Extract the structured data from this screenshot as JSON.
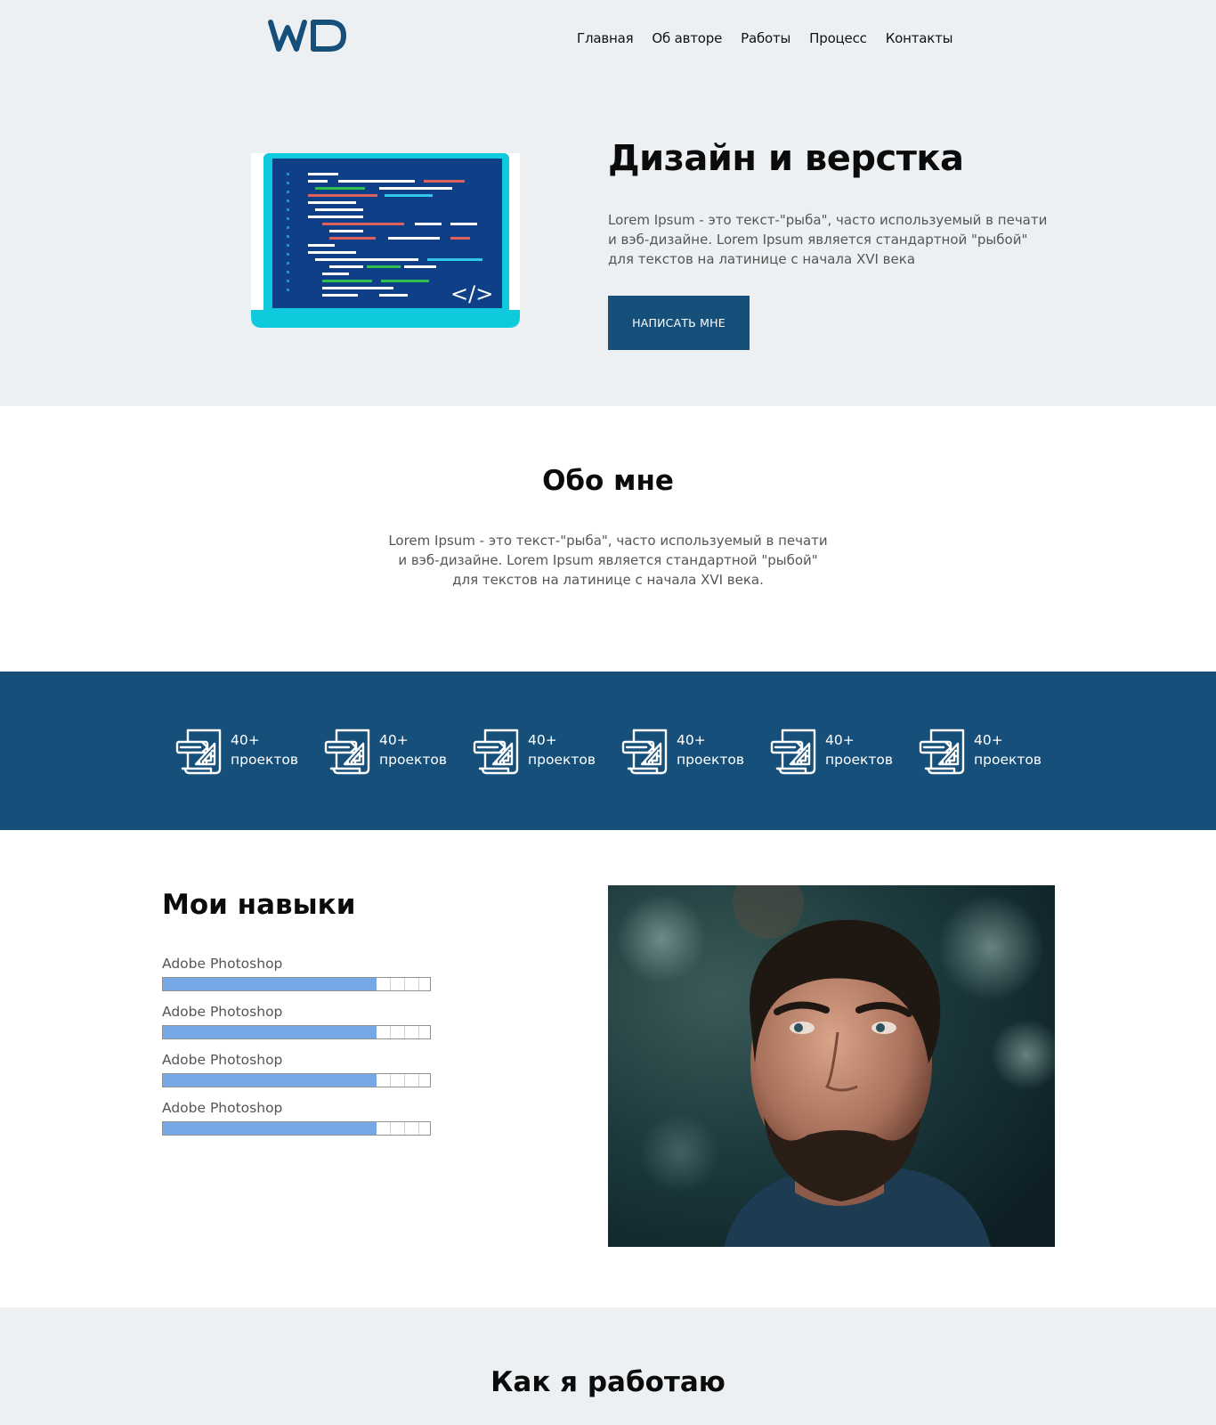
{
  "header": {
    "logo_text": "WD",
    "nav": [
      "Главная",
      "Об авторе",
      "Работы",
      "Процесс",
      "Контакты"
    ]
  },
  "hero": {
    "title": "Дизайн и верстка",
    "text": "Lorem Ipsum - это текст-\"рыба\", часто используемый в печати и вэб-дизайне. Lorem Ipsum является стандартной \"рыбой\" для текстов на латинице с начала XVI века",
    "button_label": "НАПИСАТЬ МНЕ",
    "code_glyph": "</>"
  },
  "about": {
    "title": "Обо мне",
    "text": "Lorem Ipsum - это текст-\"рыба\", часто используемый в печати и вэб-дизайне. Lorem Ipsum является стандартной \"рыбой\" для текстов на латинице с начала XVI века."
  },
  "stats": [
    {
      "value": "40+",
      "label": "проектов",
      "icon": "blueprint-icon"
    },
    {
      "value": "40+",
      "label": "проектов",
      "icon": "blueprint-icon"
    },
    {
      "value": "40+",
      "label": "проектов",
      "icon": "blueprint-icon"
    },
    {
      "value": "40+",
      "label": "проектов",
      "icon": "blueprint-icon"
    },
    {
      "value": "40+",
      "label": "проектов",
      "icon": "blueprint-icon"
    },
    {
      "value": "40+",
      "label": "проектов",
      "icon": "blueprint-icon"
    }
  ],
  "skills": {
    "title": "Мои навыки",
    "items": [
      {
        "label": "Adobe Photoshop",
        "level": 0.8
      },
      {
        "label": "Adobe Photoshop",
        "level": 0.8
      },
      {
        "label": "Adobe Photoshop",
        "level": 0.8
      },
      {
        "label": "Adobe Photoshop",
        "level": 0.8
      }
    ]
  },
  "process": {
    "title": "Как я работаю"
  },
  "colors": {
    "primary": "#154f7a",
    "light_bg": "#edf0f3",
    "skill_fill": "#76a8e8",
    "laptop_frame": "#0fc9dc",
    "laptop_screen": "#0f3f86"
  }
}
